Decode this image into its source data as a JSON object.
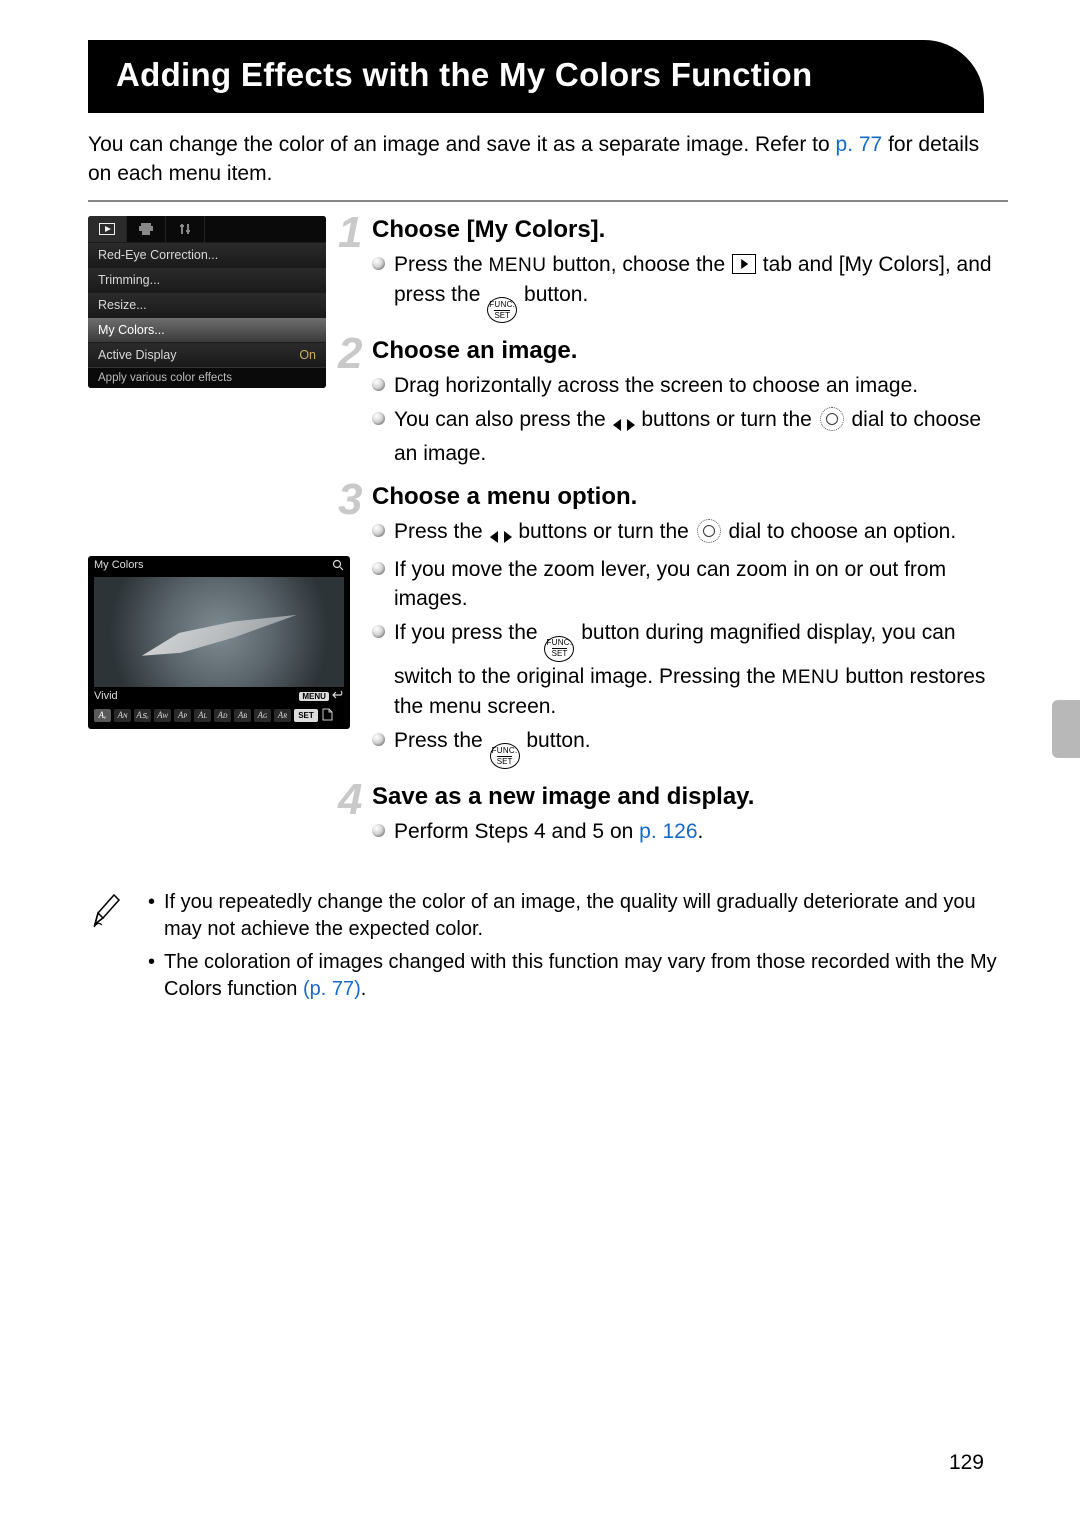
{
  "title": "Adding Effects with the My Colors Function",
  "intro_a": "You can change the color of an image and save it as a separate image. Refer to ",
  "intro_link1": "p. 77",
  "intro_b": " for details on each menu item.",
  "menu_screenshot": {
    "items": [
      {
        "label": "Red-Eye Correction...",
        "value": ""
      },
      {
        "label": "Trimming...",
        "value": ""
      },
      {
        "label": "Resize...",
        "value": ""
      },
      {
        "label": "My Colors...",
        "value": "",
        "selected": true
      },
      {
        "label": "Active Display",
        "value": "On"
      }
    ],
    "footer": "Apply various color effects"
  },
  "preview_screenshot": {
    "title": "My Colors",
    "option_label": "Vivid",
    "menu_label": "MENU",
    "set_label": "SET",
    "chips": [
      "Aᵥ",
      "Aɴ",
      "Aꜱₑ",
      "Aᴡ",
      "Aᴘ",
      "Aʟ",
      "Aᴅ",
      "Aʙ",
      "Aɢ",
      "Aʀ"
    ]
  },
  "steps": [
    {
      "num": "1",
      "title": "Choose [My Colors].",
      "bullets": [
        {
          "parts": [
            "Press the ",
            {
              "kind": "menu"
            },
            " button, choose the ",
            {
              "kind": "playtab"
            },
            " tab and [My Colors], and press the ",
            {
              "kind": "funcset"
            },
            " button."
          ]
        }
      ]
    },
    {
      "num": "2",
      "title": "Choose an image.",
      "bullets": [
        {
          "parts": [
            "Drag horizontally across the screen to choose an image."
          ]
        },
        {
          "parts": [
            "You can also press the ",
            {
              "kind": "lr"
            },
            " buttons or turn the ",
            {
              "kind": "dial"
            },
            " dial to choose an image."
          ]
        }
      ]
    },
    {
      "num": "3",
      "title": "Choose a menu option.",
      "bullets": [
        {
          "parts": [
            "Press the ",
            {
              "kind": "lr"
            },
            " buttons or turn the ",
            {
              "kind": "dial"
            },
            " dial to choose an option."
          ]
        },
        {
          "parts": [
            "If you move the zoom lever, you can zoom in on or out from images."
          ]
        },
        {
          "parts": [
            "If you press the ",
            {
              "kind": "funcset"
            },
            " button during magnified display, you can switch to the original image. Pressing the ",
            {
              "kind": "menu"
            },
            " button restores the menu screen."
          ]
        },
        {
          "parts": [
            "Press the ",
            {
              "kind": "funcset"
            },
            " button."
          ]
        }
      ]
    },
    {
      "num": "4",
      "title": "Save as a new image and display.",
      "bullets": [
        {
          "parts": [
            "Perform Steps 4 and 5 on ",
            {
              "kind": "link",
              "text": "p. 126"
            },
            "."
          ]
        }
      ]
    }
  ],
  "notes": [
    "If you repeatedly change the color of an image, the quality will gradually deteriorate and you may not achieve the expected color.",
    [
      "The coloration of images changed with this function may vary from those recorded with the My Colors function ",
      {
        "kind": "link",
        "text": "(p. 77)"
      },
      "."
    ]
  ],
  "page_number": "129",
  "glyphs": {
    "menu": "MENU",
    "funcset_top": "FUNC.",
    "funcset_bottom": "SET"
  }
}
